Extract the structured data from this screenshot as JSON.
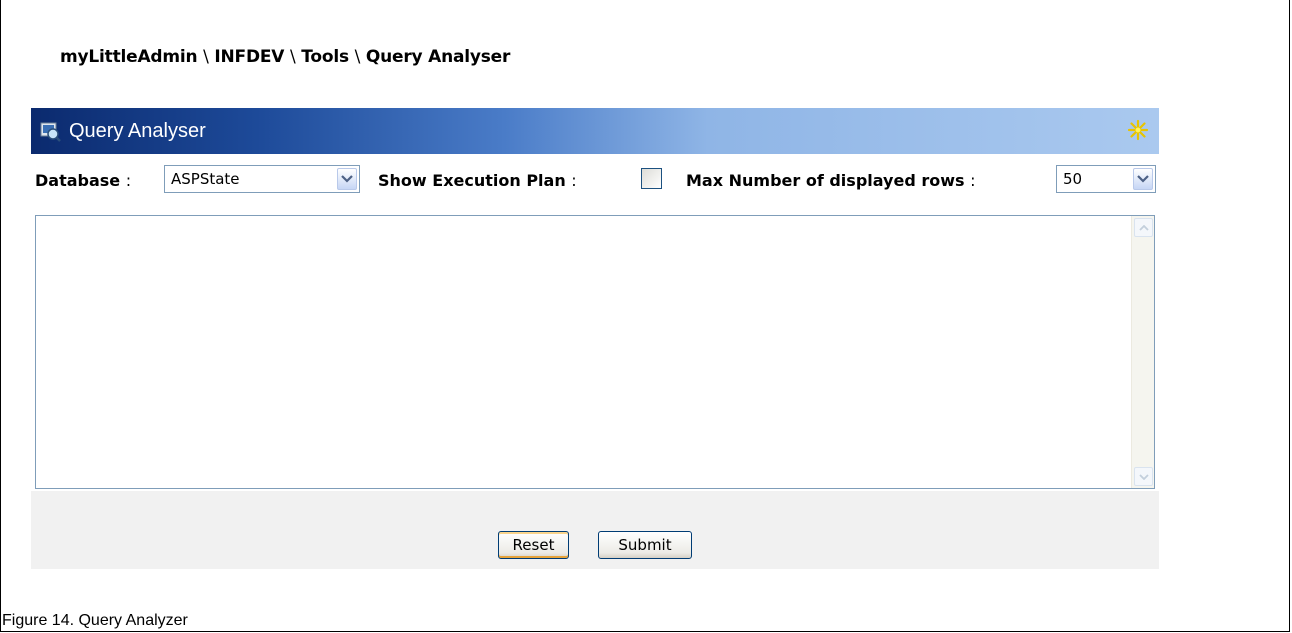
{
  "breadcrumb": {
    "items": [
      "myLittleAdmin",
      "INFDEV",
      "Tools",
      "Query Analyser"
    ],
    "separator": "\\"
  },
  "panel": {
    "title": "Query Analyser",
    "icons": {
      "app": "query-analyser-icon",
      "star": "star-icon"
    },
    "colors": {
      "title_gradient_start": "#0b2a6e",
      "title_gradient_end": "#aac9ef"
    }
  },
  "toolbar": {
    "database_label": "Database",
    "database_value": "ASPState",
    "execution_plan_label": "Show Execution Plan",
    "execution_plan_checked": false,
    "max_rows_label": "Max Number of displayed rows",
    "max_rows_value": "50",
    "colon": ":"
  },
  "query": {
    "value": ""
  },
  "buttons": {
    "reset": "Reset",
    "submit": "Submit"
  },
  "caption": "Figure 14. Query Analyzer"
}
